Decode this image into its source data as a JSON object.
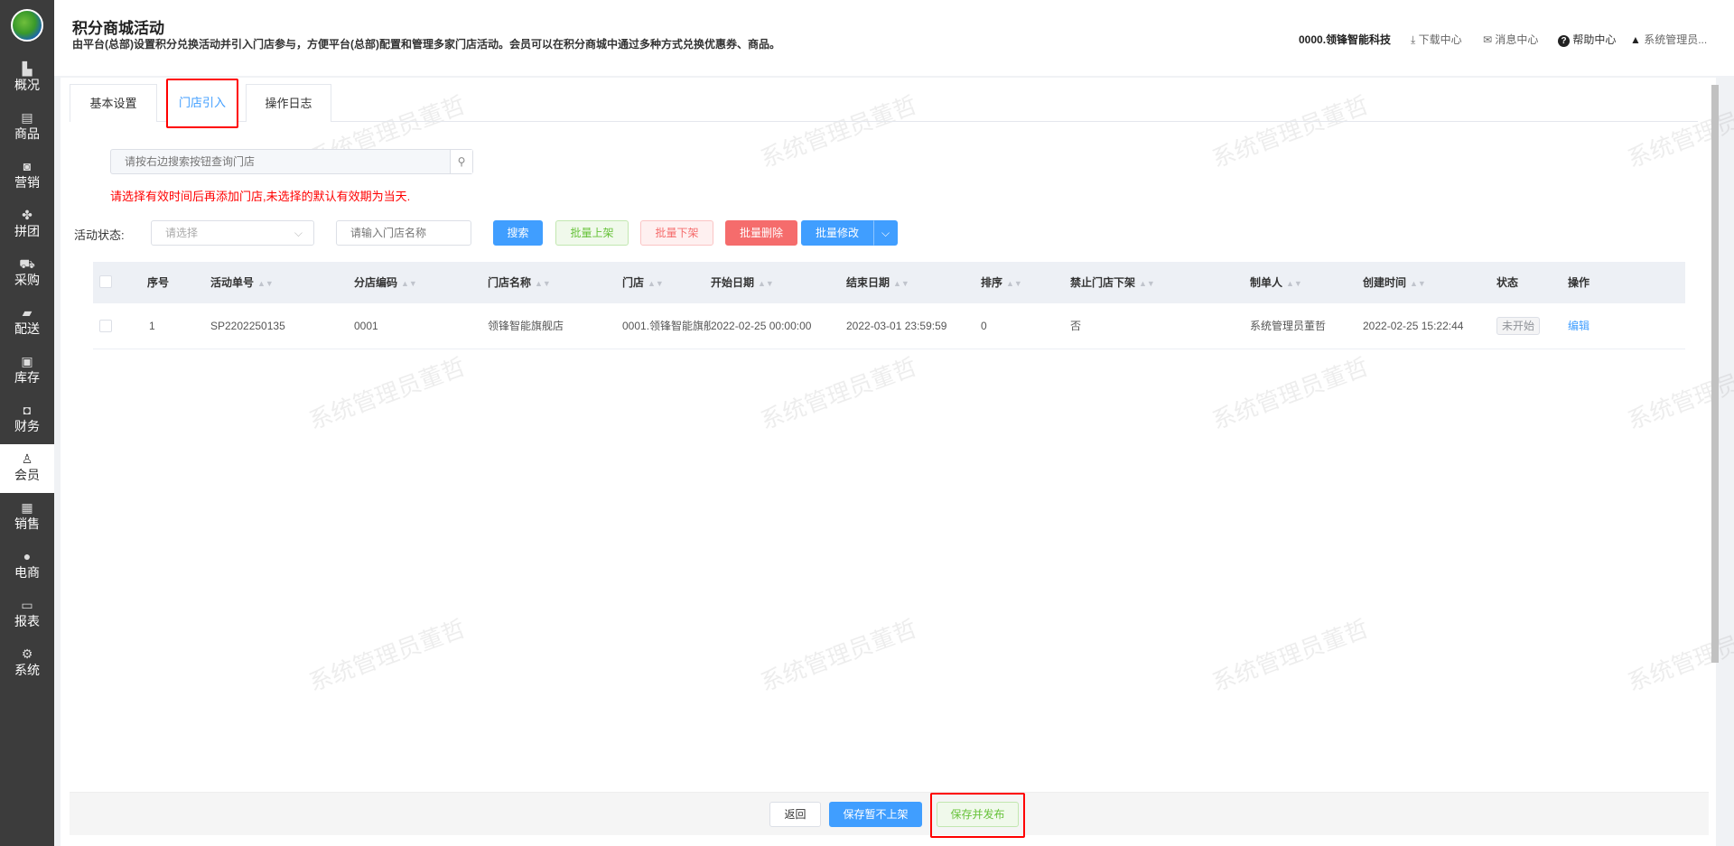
{
  "sidebar": {
    "items": [
      {
        "label": "概况",
        "icon": "building-icon",
        "glyph": "▙"
      },
      {
        "label": "商品",
        "icon": "document-icon",
        "glyph": "▤"
      },
      {
        "label": "营销",
        "icon": "marketing-icon",
        "glyph": "◙"
      },
      {
        "label": "拼团",
        "icon": "clover-icon",
        "glyph": "✤"
      },
      {
        "label": "采购",
        "icon": "cart-icon",
        "glyph": "⛟"
      },
      {
        "label": "配送",
        "icon": "truck-icon",
        "glyph": "▰"
      },
      {
        "label": "库存",
        "icon": "box-icon",
        "glyph": "▣"
      },
      {
        "label": "财务",
        "icon": "wallet-icon",
        "glyph": "◘"
      },
      {
        "label": "会员",
        "icon": "user-icon",
        "glyph": "♙"
      },
      {
        "label": "销售",
        "icon": "register-icon",
        "glyph": "▦"
      },
      {
        "label": "电商",
        "icon": "person-icon",
        "glyph": "●"
      },
      {
        "label": "报表",
        "icon": "chart-icon",
        "glyph": "▭"
      },
      {
        "label": "系统",
        "icon": "gear-icon",
        "glyph": "⚙"
      }
    ],
    "active": "会员"
  },
  "header": {
    "title": "积分商城活动",
    "subtitle": "由平台(总部)设置积分兑换活动并引入门店参与，方便平台(总部)配置和管理多家门店活动。会员可以在积分商城中通过多种方式兑换优惠券、商品。",
    "company": "0000.领锋智能科技",
    "download": "下载中心",
    "messages": "消息中心",
    "help": "帮助中心",
    "user": "系统管理员..."
  },
  "tabs": [
    "基本设置",
    "门店引入",
    "操作日志"
  ],
  "search": {
    "placeholder": "请按右边搜索按钮查询门店"
  },
  "notice": "请选择有效时间后再添加门店,未选择的默认有效期为当天.",
  "filters": {
    "status_label": "活动状态:",
    "status_placeholder": "请选择",
    "store_placeholder": "请输入门店名称"
  },
  "buttons": {
    "search": "搜索",
    "batch_on": "批量上架",
    "batch_off": "批量下架",
    "batch_delete": "批量删除",
    "batch_edit": "批量修改"
  },
  "table": {
    "headers": [
      "序号",
      "活动单号",
      "分店编码",
      "门店名称",
      "门店",
      "开始日期",
      "结束日期",
      "排序",
      "禁止门店下架",
      "制单人",
      "创建时间",
      "状态",
      "操作"
    ],
    "rows": [
      {
        "index": "1",
        "order_no": "SP2202250135",
        "branch_code": "0001",
        "store_name": "领锋智能旗舰店",
        "store": "0001.领锋智能旗舰",
        "start": "2022-02-25 00:00:00",
        "end": "2022-03-01 23:59:59",
        "sort": "0",
        "forbid_off": "否",
        "creator": "系统管理员董哲",
        "created": "2022-02-25 15:22:44",
        "status": "未开始",
        "action": "编辑"
      }
    ]
  },
  "footer": {
    "back": "返回",
    "save_draft": "保存暂不上架",
    "save_publish": "保存并发布"
  },
  "watermark": "系统管理员董哲"
}
